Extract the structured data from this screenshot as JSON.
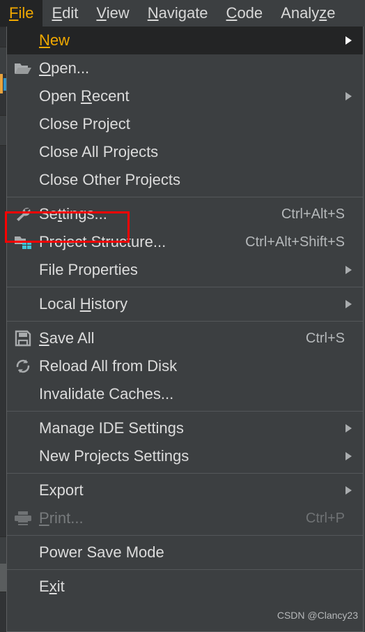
{
  "menubar": {
    "items": [
      {
        "label": "File",
        "mnemonic": "F",
        "active": true
      },
      {
        "label": "Edit",
        "mnemonic": "E",
        "active": false
      },
      {
        "label": "View",
        "mnemonic": "V",
        "active": false
      },
      {
        "label": "Navigate",
        "mnemonic": "N",
        "active": false
      },
      {
        "label": "Code",
        "mnemonic": "C",
        "active": false
      },
      {
        "label": "Analyze",
        "mnemonic": "z",
        "active": false
      }
    ]
  },
  "file_menu": {
    "items": [
      {
        "kind": "item",
        "label": "New",
        "mnemonic": "N",
        "icon": "none",
        "shortcut": "",
        "submenu": true,
        "highlighted": true,
        "accent": true,
        "disabled": false
      },
      {
        "kind": "item",
        "label": "Open...",
        "mnemonic": "O",
        "icon": "folder-open-icon",
        "shortcut": "",
        "submenu": false,
        "highlighted": false,
        "accent": false,
        "disabled": false
      },
      {
        "kind": "item",
        "label": "Open Recent",
        "mnemonic": "R",
        "icon": "none",
        "shortcut": "",
        "submenu": true,
        "highlighted": false,
        "accent": false,
        "disabled": false
      },
      {
        "kind": "item",
        "label": "Close Project",
        "mnemonic": "",
        "icon": "none",
        "shortcut": "",
        "submenu": false,
        "highlighted": false,
        "accent": false,
        "disabled": false
      },
      {
        "kind": "item",
        "label": "Close All Projects",
        "mnemonic": "",
        "icon": "none",
        "shortcut": "",
        "submenu": false,
        "highlighted": false,
        "accent": false,
        "disabled": false
      },
      {
        "kind": "item",
        "label": "Close Other Projects",
        "mnemonic": "",
        "icon": "none",
        "shortcut": "",
        "submenu": false,
        "highlighted": false,
        "accent": false,
        "disabled": false
      },
      {
        "kind": "separator"
      },
      {
        "kind": "item",
        "label": "Settings...",
        "mnemonic": "t",
        "icon": "wrench-icon",
        "shortcut": "Ctrl+Alt+S",
        "submenu": false,
        "highlighted": false,
        "accent": false,
        "disabled": false
      },
      {
        "kind": "item",
        "label": "Project Structure...",
        "mnemonic": "",
        "icon": "project-structure-icon",
        "shortcut": "Ctrl+Alt+Shift+S",
        "submenu": false,
        "highlighted": false,
        "accent": false,
        "disabled": false
      },
      {
        "kind": "item",
        "label": "File Properties",
        "mnemonic": "",
        "icon": "none",
        "shortcut": "",
        "submenu": true,
        "highlighted": false,
        "accent": false,
        "disabled": false
      },
      {
        "kind": "separator"
      },
      {
        "kind": "item",
        "label": "Local History",
        "mnemonic": "H",
        "icon": "none",
        "shortcut": "",
        "submenu": true,
        "highlighted": false,
        "accent": false,
        "disabled": false
      },
      {
        "kind": "separator"
      },
      {
        "kind": "item",
        "label": "Save All",
        "mnemonic": "S",
        "icon": "save-icon",
        "shortcut": "Ctrl+S",
        "submenu": false,
        "highlighted": false,
        "accent": false,
        "disabled": false
      },
      {
        "kind": "item",
        "label": "Reload All from Disk",
        "mnemonic": "",
        "icon": "reload-icon",
        "shortcut": "",
        "submenu": false,
        "highlighted": false,
        "accent": false,
        "disabled": false
      },
      {
        "kind": "item",
        "label": "Invalidate Caches...",
        "mnemonic": "",
        "icon": "none",
        "shortcut": "",
        "submenu": false,
        "highlighted": false,
        "accent": false,
        "disabled": false
      },
      {
        "kind": "separator"
      },
      {
        "kind": "item",
        "label": "Manage IDE Settings",
        "mnemonic": "",
        "icon": "none",
        "shortcut": "",
        "submenu": true,
        "highlighted": false,
        "accent": false,
        "disabled": false
      },
      {
        "kind": "item",
        "label": "New Projects Settings",
        "mnemonic": "",
        "icon": "none",
        "shortcut": "",
        "submenu": true,
        "highlighted": false,
        "accent": false,
        "disabled": false
      },
      {
        "kind": "separator"
      },
      {
        "kind": "item",
        "label": "Export",
        "mnemonic": "",
        "icon": "none",
        "shortcut": "",
        "submenu": true,
        "highlighted": false,
        "accent": false,
        "disabled": false
      },
      {
        "kind": "item",
        "label": "Print...",
        "mnemonic": "P",
        "icon": "printer-icon",
        "shortcut": "Ctrl+P",
        "submenu": false,
        "highlighted": false,
        "accent": false,
        "disabled": true
      },
      {
        "kind": "separator"
      },
      {
        "kind": "item",
        "label": "Power Save Mode",
        "mnemonic": "",
        "icon": "none",
        "shortcut": "",
        "submenu": false,
        "highlighted": false,
        "accent": false,
        "disabled": false
      },
      {
        "kind": "separator"
      },
      {
        "kind": "item",
        "label": "Exit",
        "mnemonic": "x",
        "icon": "none",
        "shortcut": "",
        "submenu": false,
        "highlighted": false,
        "accent": false,
        "disabled": false
      }
    ]
  },
  "annotation": {
    "target_label": "Settings...",
    "box_color": "#ff0000"
  },
  "watermark": {
    "text": "CSDN @Clancy23"
  },
  "colors": {
    "menu_background": "#3c3f41",
    "highlight_background": "#232425",
    "accent": "#f0a800",
    "text": "#dcdcdc",
    "shortcut_text": "#b5b8ba",
    "disabled_text": "#777a7c",
    "separator": "#54575a"
  }
}
